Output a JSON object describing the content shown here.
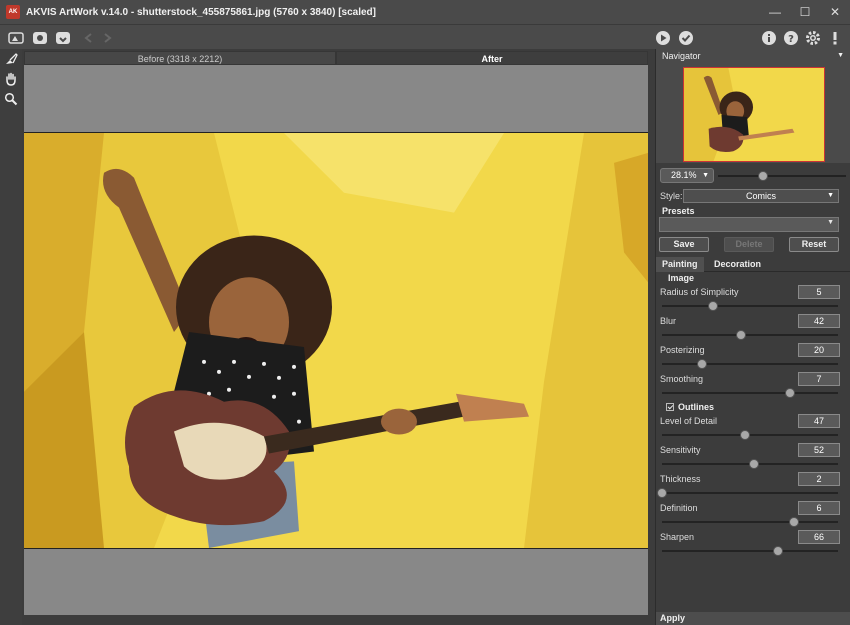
{
  "titlebar": {
    "title": "AKVIS ArtWork v.14.0 - shutterstock_455875861.jpg (5760 x 3840) [scaled]",
    "minimize": "—",
    "maximize": "☐",
    "close": "✕"
  },
  "canvas": {
    "before_tab": "Before (3318 x 2212)",
    "after_tab": "After",
    "accent_bg": "#f0d84a"
  },
  "navigator": {
    "title": "Navigator",
    "zoom": "28.1%",
    "zoom_level": 0.35
  },
  "settings": {
    "style_label": "Style:",
    "style_value": "Comics",
    "presets_label": "Presets",
    "save": "Save",
    "delete": "Delete",
    "reset": "Reset",
    "tabs": [
      "Painting",
      "Decoration"
    ],
    "image_section": "Image",
    "outlines_section": "Outlines",
    "apply": "Apply",
    "image_params": [
      {
        "label": "Radius of Simplicity",
        "value": "5",
        "level": 0.29
      },
      {
        "label": "Blur",
        "value": "42",
        "level": 0.45
      },
      {
        "label": "Posterizing",
        "value": "20",
        "level": 0.23
      },
      {
        "label": "Smoothing",
        "value": "7",
        "level": 0.73
      }
    ],
    "outline_params": [
      {
        "label": "Level of Detail",
        "value": "47",
        "level": 0.47
      },
      {
        "label": "Sensitivity",
        "value": "52",
        "level": 0.52
      },
      {
        "label": "Thickness",
        "value": "2",
        "level": 0.0
      },
      {
        "label": "Definition",
        "value": "6",
        "level": 0.75
      },
      {
        "label": "Sharpen",
        "value": "66",
        "level": 0.66
      }
    ]
  }
}
